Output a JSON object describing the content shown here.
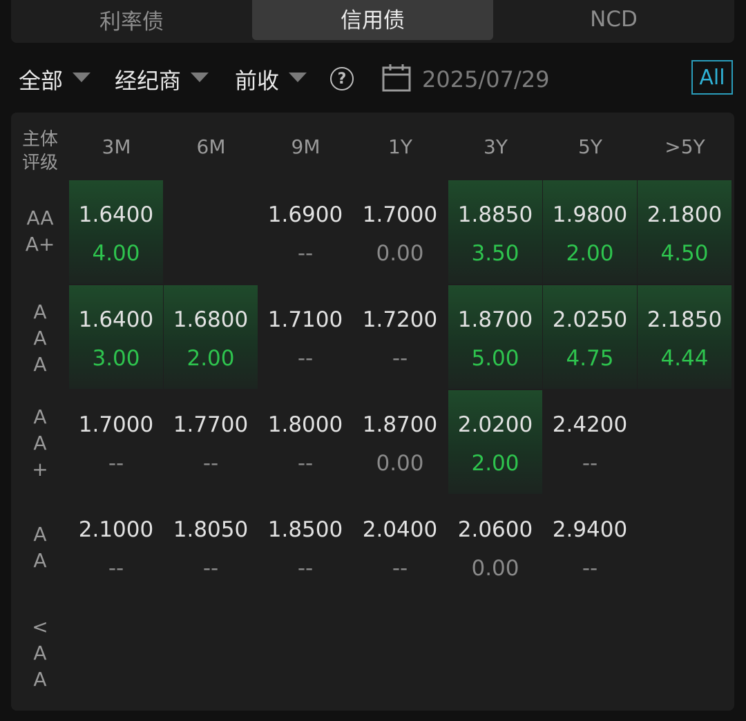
{
  "tabs": [
    "利率债",
    "信用债",
    "NCD"
  ],
  "active_tab": 1,
  "filters": {
    "scope": "全部",
    "broker": "经纪商",
    "price": "前收",
    "help": "?",
    "date": "2025/07/29",
    "all": "All"
  },
  "grid": {
    "corner": [
      "主体",
      "评级"
    ],
    "columns": [
      "3M",
      "6M",
      "9M",
      "1Y",
      "3Y",
      "5Y",
      ">5Y"
    ],
    "rows": [
      {
        "label": [
          "AA",
          "A+"
        ],
        "cells": [
          {
            "rate": "1.6400",
            "vol": "4.00",
            "hl": true
          },
          null,
          {
            "rate": "1.6900",
            "vol": "--",
            "hl": false
          },
          {
            "rate": "1.7000",
            "vol": "0.00",
            "hl": false
          },
          {
            "rate": "1.8850",
            "vol": "3.50",
            "hl": true
          },
          {
            "rate": "1.9800",
            "vol": "2.00",
            "hl": true
          },
          {
            "rate": "2.1800",
            "vol": "4.50",
            "hl": true
          }
        ]
      },
      {
        "label": [
          "A",
          "A",
          "A"
        ],
        "cells": [
          {
            "rate": "1.6400",
            "vol": "3.00",
            "hl": true
          },
          {
            "rate": "1.6800",
            "vol": "2.00",
            "hl": true
          },
          {
            "rate": "1.7100",
            "vol": "--",
            "hl": false
          },
          {
            "rate": "1.7200",
            "vol": "--",
            "hl": false
          },
          {
            "rate": "1.8700",
            "vol": "5.00",
            "hl": true
          },
          {
            "rate": "2.0250",
            "vol": "4.75",
            "hl": true
          },
          {
            "rate": "2.1850",
            "vol": "4.44",
            "hl": true
          }
        ]
      },
      {
        "label": [
          "A",
          "A",
          "+"
        ],
        "cells": [
          {
            "rate": "1.7000",
            "vol": "--",
            "hl": false
          },
          {
            "rate": "1.7700",
            "vol": "--",
            "hl": false
          },
          {
            "rate": "1.8000",
            "vol": "--",
            "hl": false
          },
          {
            "rate": "1.8700",
            "vol": "0.00",
            "hl": false
          },
          {
            "rate": "2.0200",
            "vol": "2.00",
            "hl": true
          },
          {
            "rate": "2.4200",
            "vol": "--",
            "hl": false
          },
          null
        ]
      },
      {
        "label": [
          "A",
          "A"
        ],
        "cells": [
          {
            "rate": "2.1000",
            "vol": "--",
            "hl": false
          },
          {
            "rate": "1.8050",
            "vol": "--",
            "hl": false
          },
          {
            "rate": "1.8500",
            "vol": "--",
            "hl": false
          },
          {
            "rate": "2.0400",
            "vol": "--",
            "hl": false
          },
          {
            "rate": "2.0600",
            "vol": "0.00",
            "hl": false
          },
          {
            "rate": "2.9400",
            "vol": "--",
            "hl": false
          },
          null
        ]
      },
      {
        "label": [
          "<",
          "A",
          "A"
        ],
        "cells": [
          null,
          null,
          null,
          null,
          null,
          null,
          null
        ]
      }
    ]
  },
  "colors": {
    "background": "#111111",
    "panel": "#1e1e1e",
    "highlight_cell": "#1f4a2b",
    "positive_volume": "#2ec44e",
    "muted_text": "#8a8a8a",
    "accent": "#2fb2d6"
  }
}
